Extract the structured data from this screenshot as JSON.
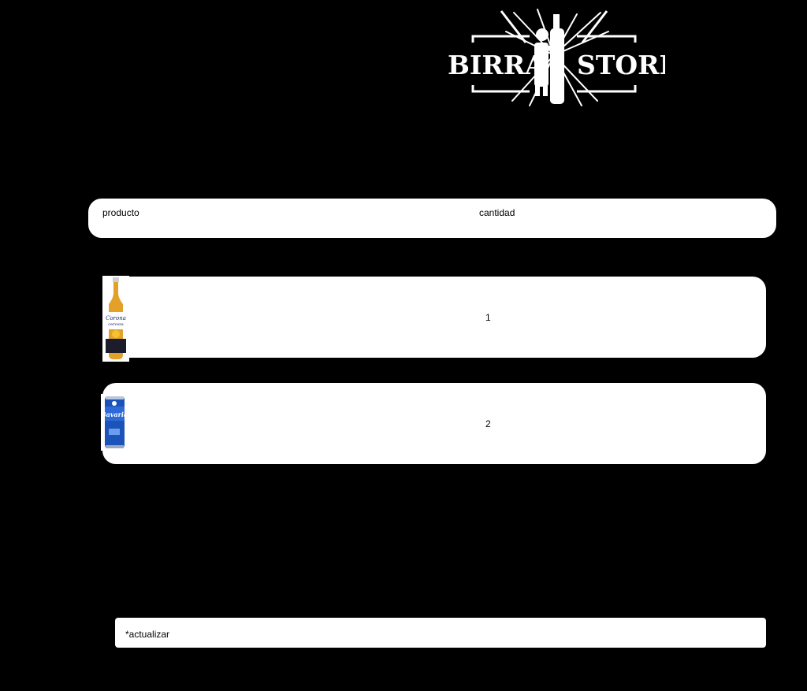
{
  "brand": {
    "left_word": "BIRRA",
    "right_word": "STORE"
  },
  "table": {
    "headers": {
      "product": "producto",
      "quantity": "cantidad"
    },
    "items": [
      {
        "image": "corona-bottle-image",
        "quantity": "1"
      },
      {
        "image": "bavaria-can-image",
        "quantity": "2"
      }
    ]
  },
  "update_action": {
    "label": "*actualizar"
  },
  "colors": {
    "background": "#000000",
    "card": "#ffffff",
    "text": "#000000"
  }
}
